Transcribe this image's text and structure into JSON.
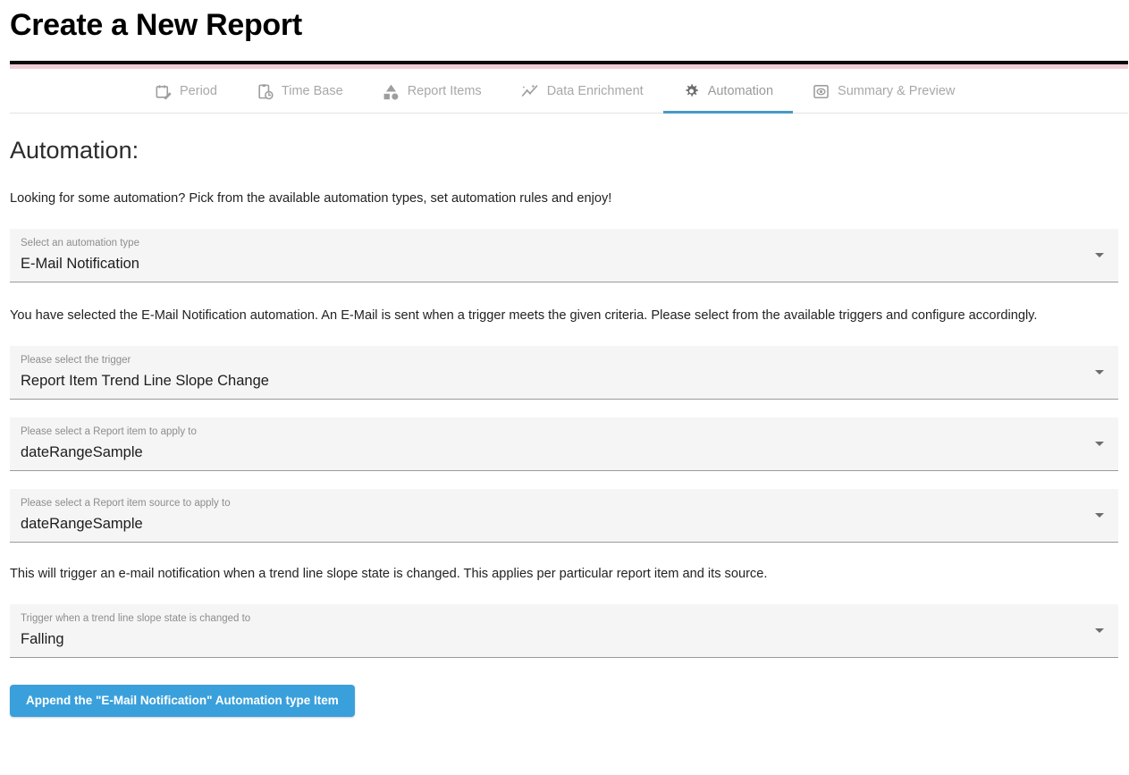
{
  "header": {
    "title": "Create a New Report",
    "divider_dark_color": "#0d0a0c",
    "divider_accent_color": "#f0cdd5"
  },
  "tabs": {
    "active_index": 4,
    "active_underline_color": "#4a9ac6",
    "items": [
      {
        "label": "Period",
        "icon": "calendar-edit-icon"
      },
      {
        "label": "Time Base",
        "icon": "clipboard-clock-icon"
      },
      {
        "label": "Report Items",
        "icon": "shapes-icon"
      },
      {
        "label": "Data Enrichment",
        "icon": "trend-sparkle-icon"
      },
      {
        "label": "Automation",
        "icon": "gear-icon"
      },
      {
        "label": "Summary & Preview",
        "icon": "eye-preview-icon"
      }
    ]
  },
  "main": {
    "section_heading": "Automation:",
    "intro_paragraph": "Looking for some automation? Pick from the available automation types, set automation rules and enjoy!",
    "automation_type": {
      "label": "Select an automation type",
      "value": "E-Mail Notification"
    },
    "selection_paragraph": "You have selected the E-Mail Notification automation. An E-Mail is sent when a trigger meets the given criteria. Please select from the available triggers and configure accordingly.",
    "trigger": {
      "label": "Please select the trigger",
      "value": "Report Item Trend Line Slope Change"
    },
    "report_item": {
      "label": "Please select a Report item to apply to",
      "value": "dateRangeSample"
    },
    "report_item_source": {
      "label": "Please select a Report item source to apply to",
      "value": "dateRangeSample"
    },
    "trigger_paragraph": "This will trigger an e-mail notification when a trend line slope state is changed. This applies per particular report item and its source.",
    "slope_state": {
      "label": "Trigger when a trend line slope state is changed to",
      "value": "Falling"
    },
    "append_button": {
      "label": "Append the \"E-Mail Notification\" Automation type Item",
      "color": "#3aa0dc"
    }
  }
}
